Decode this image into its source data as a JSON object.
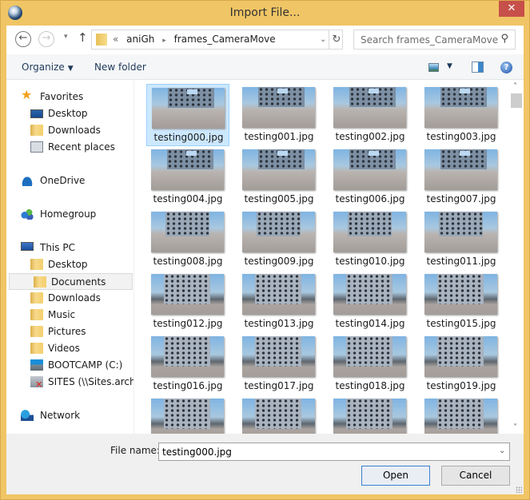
{
  "window": {
    "title": "Import File...",
    "close_label": "✕"
  },
  "nav": {
    "back_icon": "←",
    "forward_icon": "→",
    "recent_icon": "▾",
    "up_icon": "↑",
    "breadcrumb_overflow": "«",
    "breadcrumb": [
      "aniGh",
      "frames_CameraMove"
    ],
    "breadcrumb_sep": "▸",
    "address_dropdown_icon": "⌄",
    "refresh_icon": "↻",
    "search_placeholder": "Search frames_CameraMove",
    "search_icon": "⚲"
  },
  "toolbar": {
    "organize_label": "Organize",
    "organize_caret": "▼",
    "new_folder_label": "New folder",
    "view_caret": "▼",
    "help_label": "?"
  },
  "sidebar": {
    "items": [
      {
        "label": "Favorites",
        "icon": "star-icon",
        "level": 0
      },
      {
        "label": "Desktop",
        "icon": "desktop-icon",
        "level": 1
      },
      {
        "label": "Downloads",
        "icon": "downloads-folder-icon",
        "level": 1
      },
      {
        "label": "Recent places",
        "icon": "recent-places-icon",
        "level": 1
      },
      {
        "label": "OneDrive",
        "icon": "onedrive-icon",
        "level": 0
      },
      {
        "label": "Homegroup",
        "icon": "homegroup-icon",
        "level": 0
      },
      {
        "label": "This PC",
        "icon": "this-pc-icon",
        "level": 0
      },
      {
        "label": "Desktop",
        "icon": "desktop-folder-icon",
        "level": 1
      },
      {
        "label": "Documents",
        "icon": "documents-folder-icon",
        "level": 1,
        "selected": true
      },
      {
        "label": "Downloads",
        "icon": "downloads-folder-icon",
        "level": 1
      },
      {
        "label": "Music",
        "icon": "music-folder-icon",
        "level": 1
      },
      {
        "label": "Pictures",
        "icon": "pictures-folder-icon",
        "level": 1
      },
      {
        "label": "Videos",
        "icon": "videos-folder-icon",
        "level": 1
      },
      {
        "label": "BOOTCAMP (C:)",
        "icon": "drive-icon",
        "level": 1
      },
      {
        "label": "SITES (\\\\Sites.arch.vi",
        "icon": "network-drive-disconnected-icon",
        "level": 1
      },
      {
        "label": "Network",
        "icon": "network-icon",
        "level": 0
      }
    ]
  },
  "files": [
    "testing000.jpg",
    "testing001.jpg",
    "testing002.jpg",
    "testing003.jpg",
    "testing004.jpg",
    "testing005.jpg",
    "testing006.jpg",
    "testing007.jpg",
    "testing008.jpg",
    "testing009.jpg",
    "testing010.jpg",
    "testing011.jpg",
    "testing012.jpg",
    "testing013.jpg",
    "testing014.jpg",
    "testing015.jpg",
    "testing016.jpg",
    "testing017.jpg",
    "testing018.jpg",
    "testing019.jpg",
    "",
    "",
    "",
    ""
  ],
  "selected_file_index": 0,
  "scroll": {
    "up_icon": "˄",
    "down_icon": "˅"
  },
  "footer": {
    "file_name_label": "File name:",
    "file_name_value": "testing000.jpg",
    "file_name_dropdown_icon": "⌄",
    "open_label": "Open",
    "cancel_label": "Cancel"
  }
}
